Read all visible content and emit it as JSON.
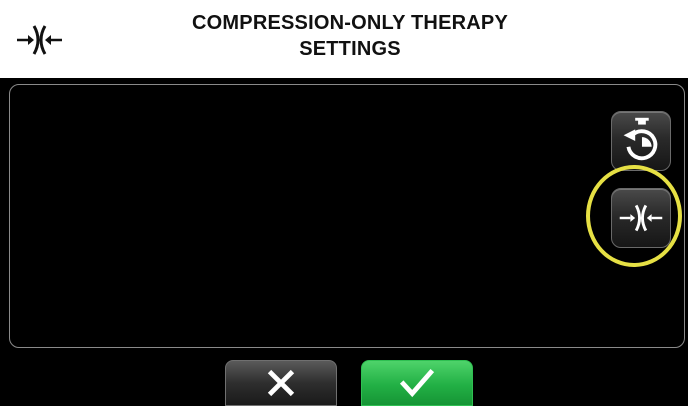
{
  "header": {
    "icon": "compression-icon",
    "title_line1": "COMPRESSION-ONLY THERAPY",
    "title_line2": "SETTINGS"
  },
  "side_buttons": [
    {
      "icon": "timer-reset-icon"
    },
    {
      "icon": "compression-icon",
      "highlighted": true
    }
  ],
  "footer_buttons": [
    {
      "icon": "close-icon",
      "color": "#2e2e2e"
    },
    {
      "icon": "check-icon",
      "color": "#22b045"
    }
  ],
  "colors": {
    "highlight_ring": "#e6e044",
    "confirm_green": "#22b045",
    "background": "#000000"
  }
}
